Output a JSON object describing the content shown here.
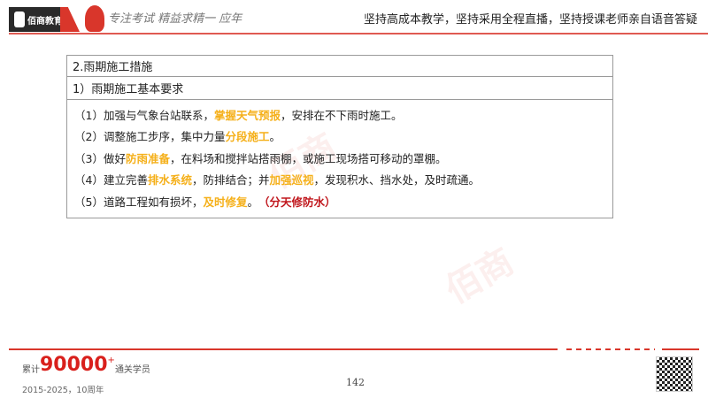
{
  "header": {
    "logo_text": "佰商教育",
    "signature": "专注考试 精益求精一 应年",
    "slogan": "坚持高成本教学，坚持采用全程直播，坚持授课老师亲自语音答疑"
  },
  "table": {
    "title": "2.雨期施工措施",
    "subtitle": "1）雨期施工基本要求",
    "lines": [
      [
        {
          "t": "（1）加强与气象台站联系，",
          "s": ""
        },
        {
          "t": "掌握天气预报",
          "s": "hl"
        },
        {
          "t": "，安排在不下雨时施工。",
          "s": ""
        }
      ],
      [
        {
          "t": "（2）调整施工步序，集中力量",
          "s": ""
        },
        {
          "t": "分段施工",
          "s": "hl"
        },
        {
          "t": "。",
          "s": ""
        }
      ],
      [
        {
          "t": "（3）做好",
          "s": ""
        },
        {
          "t": "防雨准备",
          "s": "hl"
        },
        {
          "t": "，在料场和搅拌站搭雨棚，或施工现场搭可移动的罩棚。",
          "s": ""
        }
      ],
      [
        {
          "t": "（4）建立完善",
          "s": ""
        },
        {
          "t": "排水系统",
          "s": "hl"
        },
        {
          "t": "，防排结合；并",
          "s": ""
        },
        {
          "t": "加强巡视",
          "s": "hl"
        },
        {
          "t": "，发现积水、挡水处，及时疏通。",
          "s": ""
        }
      ],
      [
        {
          "t": "（5）道路工程如有损坏，",
          "s": ""
        },
        {
          "t": "及时修复",
          "s": "hl"
        },
        {
          "t": "。 ",
          "s": ""
        },
        {
          "t": "（分天修防水）",
          "s": "red"
        }
      ]
    ]
  },
  "footer": {
    "prefix": "累计",
    "count": "90000",
    "plus": "+",
    "suffix": "通关学员",
    "years": "2015-2025，10周年",
    "page_number": "142"
  }
}
